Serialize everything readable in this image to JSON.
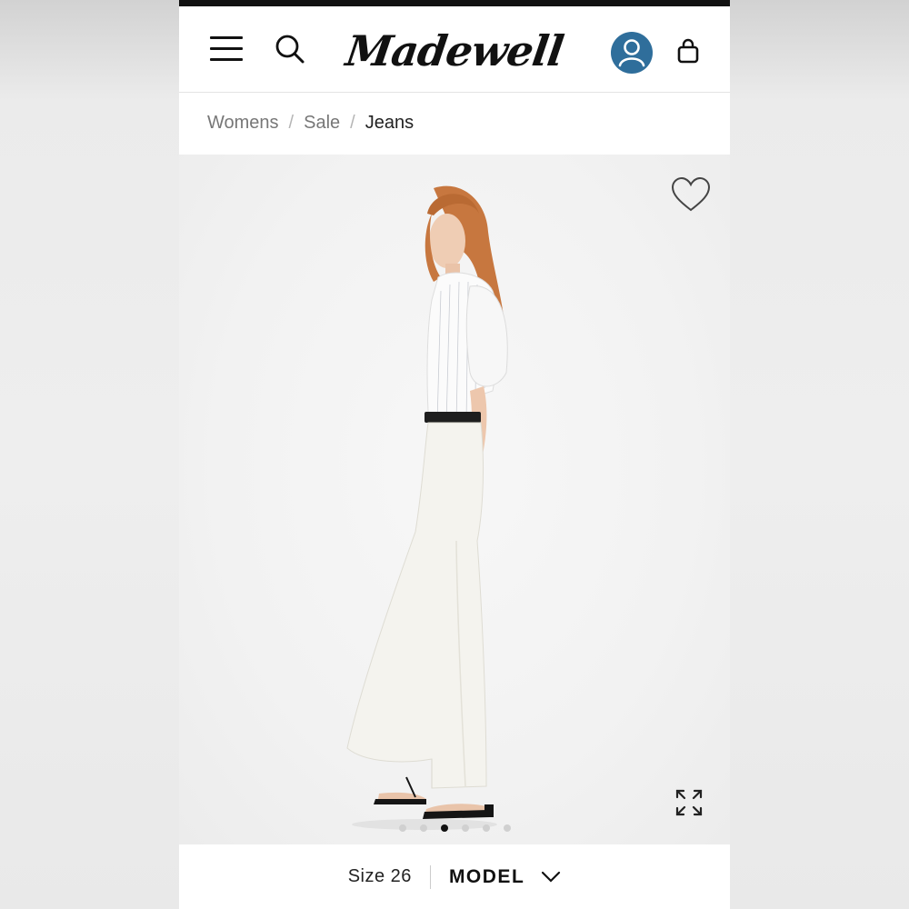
{
  "header": {
    "logo_text": "Madewell",
    "menu_icon": "hamburger-menu-icon",
    "search_icon": "search-icon",
    "account_icon": "user-account-icon",
    "bag_icon": "shopping-bag-icon",
    "account_color": "#2f6e9b"
  },
  "breadcrumb": {
    "items": [
      "Womens",
      "Sale",
      "Jeans"
    ],
    "separator": "/"
  },
  "product_image": {
    "favorite_icon": "heart-icon",
    "expand_icon": "expand-icon",
    "dot_count": 6,
    "active_dot": 3
  },
  "footer": {
    "size_label": "Size 26",
    "model_label": "MODEL",
    "chevron_icon": "chevron-down-icon"
  }
}
